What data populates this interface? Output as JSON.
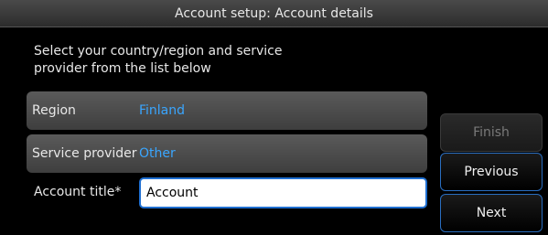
{
  "window": {
    "title": "Account setup: Account details"
  },
  "instructions": "Select your country/region and service provider from the list below",
  "region": {
    "label": "Region",
    "value": "Finland"
  },
  "provider": {
    "label": "Service provider",
    "value": "Other"
  },
  "account_title": {
    "label": "Account title*",
    "value": "Account"
  },
  "buttons": {
    "finish": "Finish",
    "previous": "Previous",
    "next": "Next"
  },
  "colors": {
    "accent": "#3aa6ff",
    "button_border": "#2a6ec0",
    "background": "#000000"
  }
}
